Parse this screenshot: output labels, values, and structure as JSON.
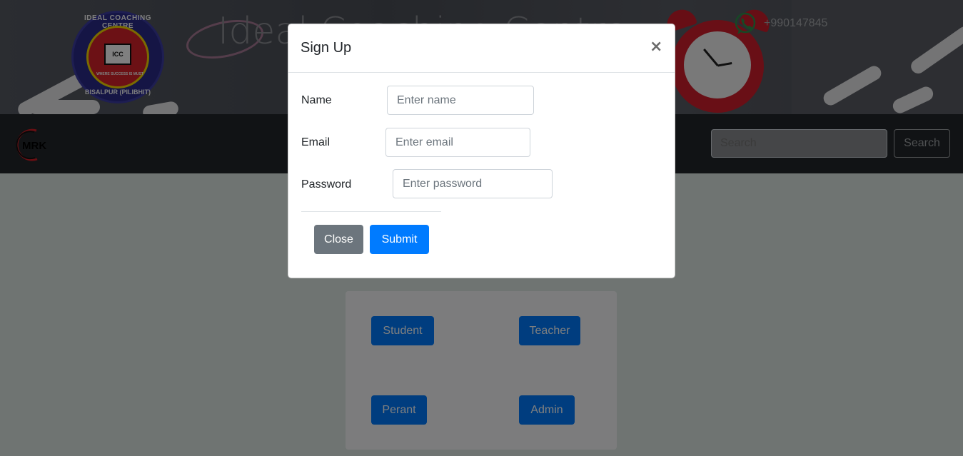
{
  "header": {
    "logo": {
      "ring_top": "IDEAL COACHING CENTRE",
      "book_text": "ICC",
      "tagline": "WHERE SUCCESS IS MUST",
      "ring_bottom": "BISALPUR (PILIBHIT)"
    },
    "title": "Ideal Coaching Centre",
    "phone": "+990147845",
    "whatsapp_icon": "whatsapp-icon"
  },
  "navbar": {
    "brand_text": "MRK",
    "search": {
      "placeholder": "Search",
      "button_label": "Search"
    }
  },
  "roles": {
    "student": "Student",
    "teacher": "Teacher",
    "parent": "Perant",
    "admin": "Admin"
  },
  "modal": {
    "title": "Sign Up",
    "close_symbol": "×",
    "fields": {
      "name": {
        "label": "Name",
        "placeholder": "Enter name"
      },
      "email": {
        "label": "Email",
        "placeholder": "Enter email"
      },
      "password": {
        "label": "Password",
        "placeholder": "Enter password"
      }
    },
    "close_label": "Close",
    "submit_label": "Submit"
  },
  "colors": {
    "primary": "#007bff",
    "secondary": "#6c757d",
    "navbar": "#23272b"
  }
}
